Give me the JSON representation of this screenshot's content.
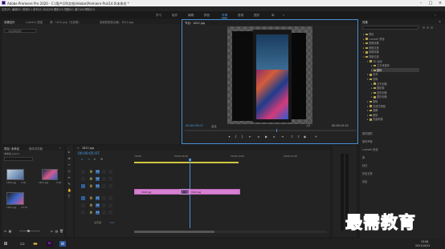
{
  "window": {
    "title": "Adobe Premiere Pro 2020 - C:\\用户\\19\\文档\\Adobe\\Premiere Pro\\14.0\\未命名 *"
  },
  "menu": [
    "文件(F)",
    "编辑(E)",
    "剪辑(C)",
    "序列(S)",
    "标记(M)",
    "图形(G)",
    "视图(V)",
    "窗口(W)",
    "帮助(H)"
  ],
  "workspaces": [
    "学习",
    "组件",
    "编辑",
    "颜色",
    "效果",
    "音频",
    "图形",
    "库"
  ],
  "left_panel": {
    "tabs": [
      "效果控件",
      "Lumetri 范围",
      "源：1812.jpg（无剪辑）",
      "音频剪辑混合器：1812.jpg"
    ],
    "empty_text": "（未选择剪辑）"
  },
  "program": {
    "tab": "节目：1812.jpg",
    "timecode_left": "00:00:05:07",
    "fit": "适合",
    "ratio": "1/2",
    "timecode_right": "00:00:10:10"
  },
  "effects_panel": {
    "title": "效果",
    "search_placeholder": "",
    "items": [
      {
        "label": "预设",
        "level": 0,
        "open": false
      },
      {
        "label": "Lumetri 预设",
        "level": 0,
        "open": false
      },
      {
        "label": "音频效果",
        "level": 0,
        "open": false
      },
      {
        "label": "音频过渡",
        "level": 0,
        "open": false
      },
      {
        "label": "视频效果",
        "level": 0,
        "open": false
      },
      {
        "label": "视频过渡",
        "level": 0,
        "open": true
      },
      {
        "label": "3D 运动",
        "level": 1,
        "open": true
      },
      {
        "label": "立方体旋转",
        "level": 2,
        "open": false
      },
      {
        "label": "翻转",
        "level": 2,
        "open": false,
        "selected": true
      },
      {
        "label": "内滑",
        "level": 1,
        "open": false
      },
      {
        "label": "划像",
        "level": 1,
        "open": true
      },
      {
        "label": "交叉划像",
        "level": 2,
        "open": false
      },
      {
        "label": "圆划像",
        "level": 2,
        "open": false
      },
      {
        "label": "盒形划像",
        "level": 2,
        "open": false
      },
      {
        "label": "菱形划像",
        "level": 2,
        "open": false
      },
      {
        "label": "擦除",
        "level": 1,
        "open": false
      },
      {
        "label": "沉浸式视频",
        "level": 1,
        "open": false
      },
      {
        "label": "溶解",
        "level": 1,
        "open": false
      },
      {
        "label": "缩放",
        "level": 1,
        "open": false
      },
      {
        "label": "页面剥落",
        "level": 1,
        "open": false
      }
    ],
    "bottom": [
      "基本图形",
      "基本声音",
      "Lumetri 颜色",
      "库",
      "标记",
      "历史记录",
      "信息"
    ]
  },
  "project_panel": {
    "tabs": [
      "项目: 未命名",
      "媒体浏览器"
    ],
    "name": "未命名.prproj",
    "items": [
      {
        "name": "1810.jpg",
        "duration": "5:00"
      },
      {
        "name": "1811.jpg",
        "duration": "5:00"
      },
      {
        "name": "1812.jpg",
        "duration": "10:10"
      }
    ]
  },
  "timeline": {
    "tab": "1812.jpg",
    "timecode": "00:00:05:07",
    "ruler": [
      ":00:00",
      "00:00:05:00",
      "00:00:10:00",
      "00:00:15:00"
    ],
    "tracks": [
      "V3",
      "V2",
      "V1",
      "A1",
      "A2",
      "A3"
    ],
    "master": "主声道",
    "master_value": "0.0",
    "clips": [
      {
        "label": "1810.jpg",
        "start_frac": 0.0
      },
      {
        "label": "1811.jpg",
        "start_frac": 0.6
      }
    ],
    "transition": "翻转"
  },
  "watermark": "最需教育",
  "taskbar": {
    "time": "15:08",
    "date": "2021/10/21"
  },
  "colors": {
    "accent": "#4a8fd6",
    "clip": "#d77fd0",
    "brand": "#2a0a3a"
  }
}
